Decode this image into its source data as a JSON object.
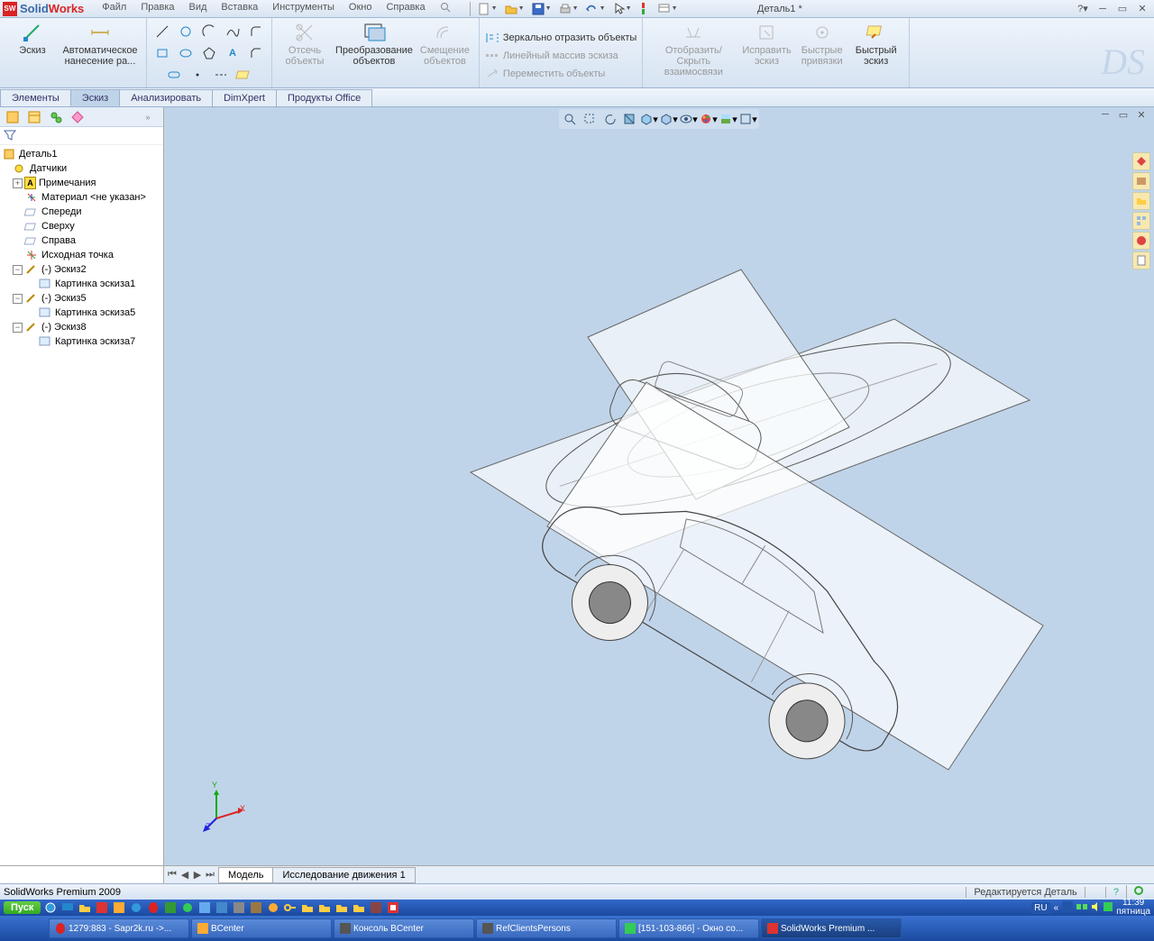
{
  "app": {
    "name_solid": "Solid",
    "name_works": "Works"
  },
  "menus": [
    "Файл",
    "Правка",
    "Вид",
    "Вставка",
    "Инструменты",
    "Окно",
    "Справка"
  ],
  "document_title": "Деталь1 *",
  "ribbon": {
    "sketch_btn": "Эскиз",
    "auto_dim": "Автоматическое\nнанесение ра...",
    "trim": "Отсечь\nобъекты",
    "convert": "Преобразование\nобъектов",
    "offset": "Смещение\nобъектов",
    "mirror": "Зеркально отразить объекты",
    "linear_pattern": "Линейный массив эскиза",
    "move": "Переместить объекты",
    "display_hide": "Отобразить/Скрыть\nвзаимосвязи",
    "fix": "Исправить\nэскиз",
    "quick_snaps": "Быстрые\nпривязки",
    "quick_sketch": "Быстрый\nэскиз"
  },
  "tabs": [
    "Элементы",
    "Эскиз",
    "Анализировать",
    "DimXpert",
    "Продукты Office"
  ],
  "tree": {
    "root": "Деталь1",
    "items": [
      "Датчики",
      "Примечания",
      "Материал <не указан>",
      "Спереди",
      "Сверху",
      "Справа",
      "Исходная точка",
      "(-) Эскиз2",
      "Картинка эскиза1",
      "(-) Эскиз5",
      "Картинка эскиза5",
      "(-) Эскиз8",
      "Картинка эскиза7"
    ]
  },
  "bottom_tabs": {
    "model": "Модель",
    "motion": "Исследование движения 1"
  },
  "status": {
    "product": "SolidWorks Premium 2009",
    "editing": "Редактируется Деталь"
  },
  "triad": {
    "x": "X",
    "y": "Y",
    "z": "Z"
  },
  "taskbar": {
    "start": "Пуск",
    "tasks": [
      "1279:883 - Sapr2k.ru ->...",
      "BCenter",
      "Консоль BCenter",
      "RefClientsPersons",
      "[151-103-866] - Окно со...",
      "SolidWorks Premium ..."
    ],
    "lang": "RU",
    "time": "11:39",
    "day": "пятница"
  }
}
